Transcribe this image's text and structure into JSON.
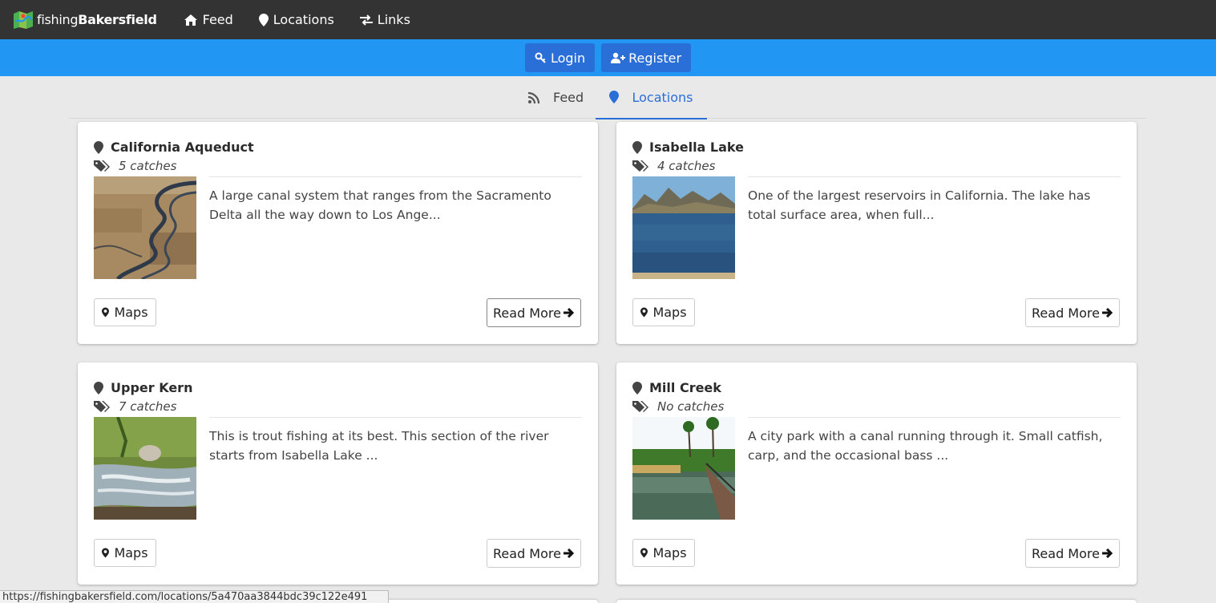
{
  "brand": {
    "prefix": "fishing",
    "name": "Bakersfield"
  },
  "nav": [
    {
      "label": "Feed",
      "icon": "home-icon"
    },
    {
      "label": "Locations",
      "icon": "map-marker-icon"
    },
    {
      "label": "Links",
      "icon": "exchange-icon"
    }
  ],
  "auth": {
    "login": "Login",
    "register": "Register"
  },
  "tabs": {
    "feed": "Feed",
    "locations": "Locations",
    "active": "Locations"
  },
  "colors": {
    "navbar": "#333333",
    "authbar": "#2196f3",
    "button": "#2a6fd8",
    "active_tab": "#2a6fd8"
  },
  "cards": [
    {
      "title": "California Aqueduct",
      "catches": "5 catches",
      "description": "A large canal system that ranges from the Sacramento Delta all the way down to Los Ange...",
      "maps_label": "Maps",
      "more_label": "Read More"
    },
    {
      "title": "Isabella Lake",
      "catches": "4 catches",
      "description": "One of the largest reservoirs in California. The lake has total surface area, when full...",
      "maps_label": "Maps",
      "more_label": "Read More"
    },
    {
      "title": "Upper Kern",
      "catches": "7 catches",
      "description": "This is trout fishing at its best. This section of the river starts from Isabella Lake ...",
      "maps_label": "Maps",
      "more_label": "Read More"
    },
    {
      "title": "Mill Creek",
      "catches": "No catches",
      "description": "A city park with a canal running through it. Small catfish, carp, and the occasional bass ...",
      "maps_label": "Maps",
      "more_label": "Read More"
    }
  ],
  "status_url": "https://fishingbakersfield.com/locations/5a470aa3844bdc39c122e491"
}
